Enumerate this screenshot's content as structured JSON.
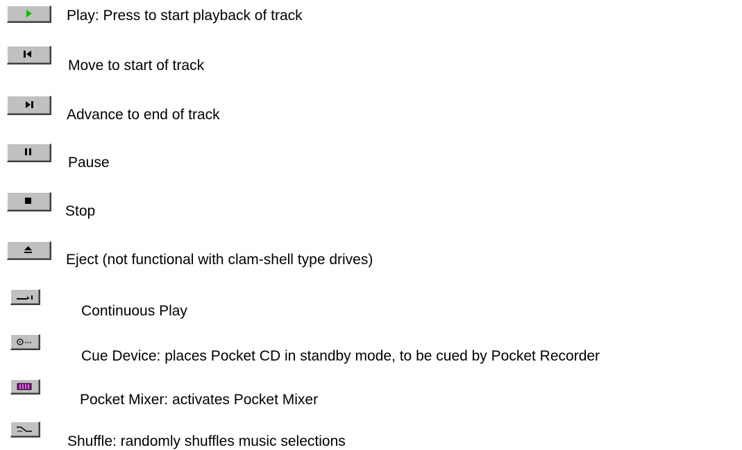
{
  "items": [
    {
      "icon": "play-icon",
      "text": "Play: Press to start playback of track",
      "accent": "#00c000"
    },
    {
      "icon": "skip-to-start-icon",
      "text": "Move to start of track"
    },
    {
      "icon": "skip-to-end-icon",
      "text": "Advance to end of track"
    },
    {
      "icon": "pause-icon",
      "text": "Pause"
    },
    {
      "icon": "stop-icon",
      "text": "Stop"
    },
    {
      "icon": "eject-icon",
      "text": "Eject (not functional with clam-shell type drives)"
    },
    {
      "icon": "continuous-play-icon",
      "text": "Continuous Play"
    },
    {
      "icon": "cue-device-icon",
      "text": "Cue Device: places Pocket CD in standby mode, to be cued by Pocket Recorder"
    },
    {
      "icon": "mixer-icon",
      "text": "Pocket Mixer: activates Pocket Mixer",
      "accent": "#800080"
    },
    {
      "icon": "shuffle-icon",
      "text": "Shuffle: randomly shuffles music selections"
    }
  ]
}
